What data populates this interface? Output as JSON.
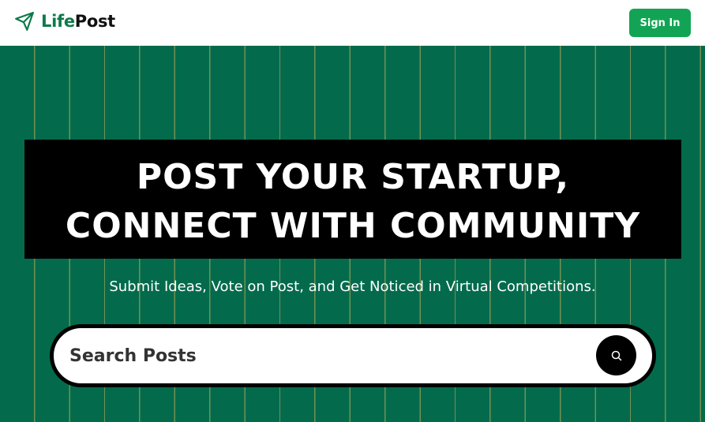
{
  "header": {
    "logo_part1": "Life",
    "logo_part2": "Post",
    "logo_icon": "paper-plane-icon",
    "signin_label": "Sign In"
  },
  "hero": {
    "headline_line1": "POST YOUR STARTUP,",
    "headline_line2": "CONNECT WITH COMMUNITY",
    "subtitle": "Submit Ideas, Vote on Post, and Get Noticed in Virtual Competitions.",
    "search": {
      "placeholder": "Search Posts",
      "icon": "search-icon"
    }
  },
  "colors": {
    "brand_green": "#036b4c",
    "button_green": "#12a454",
    "logo_accent": "#0d7a4a",
    "stripe": "#cdaf55"
  }
}
